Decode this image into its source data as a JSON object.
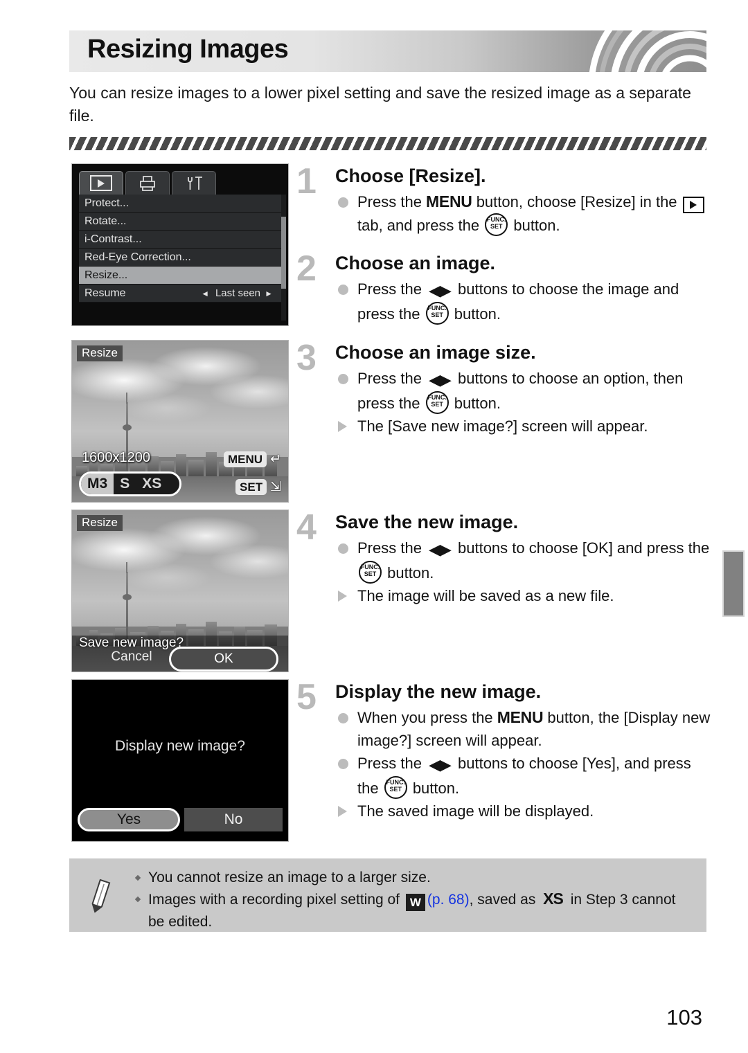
{
  "header": {
    "title": "Resizing Images",
    "intro": "You can resize images to a lower pixel setting and save the resized image as a separate file."
  },
  "camera_menu": {
    "tabs": [
      "playback-tab-icon",
      "print-tab-icon",
      "settings-tab-icon"
    ],
    "items": [
      {
        "label": "Protect...",
        "value": "",
        "selected": false
      },
      {
        "label": "Rotate...",
        "value": "",
        "selected": false
      },
      {
        "label": "i-Contrast...",
        "value": "",
        "selected": false
      },
      {
        "label": "Red-Eye Correction...",
        "value": "",
        "selected": false
      },
      {
        "label": "Resize...",
        "value": "",
        "selected": true
      },
      {
        "label": "Resume",
        "value": "Last seen",
        "selected": false
      }
    ]
  },
  "screen_resize_size": {
    "title": "Resize",
    "resolution": "1600x1200",
    "size_options": [
      "M3",
      "S",
      "XS"
    ],
    "selected_size": "M3",
    "menu_key": "MENU",
    "set_key": "SET"
  },
  "screen_save": {
    "title": "Resize",
    "question": "Save new image?",
    "cancel_label": "Cancel",
    "ok_label": "OK"
  },
  "screen_display": {
    "question": "Display new image?",
    "yes_label": "Yes",
    "no_label": "No"
  },
  "steps": [
    {
      "number": "1",
      "heading": "Choose [Resize].",
      "lines": [
        {
          "type": "dot",
          "parts": [
            {
              "t": "text",
              "v": "Press the "
            },
            {
              "t": "menu",
              "v": "MENU"
            },
            {
              "t": "text",
              "v": " button, choose [Resize] in the "
            },
            {
              "t": "play",
              "v": "playback-tab-icon"
            },
            {
              "t": "text",
              "v": " tab, and press the "
            },
            {
              "t": "func",
              "v": "FUNC./SET"
            },
            {
              "t": "text",
              "v": " button."
            }
          ]
        }
      ]
    },
    {
      "number": "2",
      "heading": "Choose an image.",
      "lines": [
        {
          "type": "dot",
          "parts": [
            {
              "t": "text",
              "v": "Press the "
            },
            {
              "t": "lr",
              "v": "◀▶"
            },
            {
              "t": "text",
              "v": " buttons to choose the image and press the "
            },
            {
              "t": "func",
              "v": "FUNC./SET"
            },
            {
              "t": "text",
              "v": " button."
            }
          ]
        }
      ]
    },
    {
      "number": "3",
      "heading": "Choose an image size.",
      "lines": [
        {
          "type": "dot",
          "parts": [
            {
              "t": "text",
              "v": "Press the "
            },
            {
              "t": "lr",
              "v": "◀▶"
            },
            {
              "t": "text",
              "v": " buttons to choose an option, then press the "
            },
            {
              "t": "func",
              "v": "FUNC./SET"
            },
            {
              "t": "text",
              "v": " button."
            }
          ]
        },
        {
          "type": "tri",
          "parts": [
            {
              "t": "text",
              "v": "The [Save new image?] screen will appear."
            }
          ]
        }
      ]
    },
    {
      "number": "4",
      "heading": "Save the new image.",
      "lines": [
        {
          "type": "dot",
          "parts": [
            {
              "t": "text",
              "v": "Press the "
            },
            {
              "t": "lr",
              "v": "◀▶"
            },
            {
              "t": "text",
              "v": " buttons to choose [OK] and press the "
            },
            {
              "t": "func",
              "v": "FUNC./SET"
            },
            {
              "t": "text",
              "v": " button."
            }
          ]
        },
        {
          "type": "tri",
          "parts": [
            {
              "t": "text",
              "v": "The image will be saved as a new file."
            }
          ]
        }
      ]
    },
    {
      "number": "5",
      "heading": "Display the new image.",
      "lines": [
        {
          "type": "dot",
          "parts": [
            {
              "t": "text",
              "v": "When you press the "
            },
            {
              "t": "menu",
              "v": "MENU"
            },
            {
              "t": "text",
              "v": " button, the [Display new image?] screen will appear."
            }
          ]
        },
        {
          "type": "dot",
          "parts": [
            {
              "t": "text",
              "v": "Press the "
            },
            {
              "t": "lr",
              "v": "◀▶"
            },
            {
              "t": "text",
              "v": " buttons to choose [Yes], and press the "
            },
            {
              "t": "func",
              "v": "FUNC./SET"
            },
            {
              "t": "text",
              "v": " button."
            }
          ]
        },
        {
          "type": "tri",
          "parts": [
            {
              "t": "text",
              "v": "The saved image will be displayed."
            }
          ]
        }
      ]
    }
  ],
  "note": {
    "icon": "pencil-icon",
    "lines": [
      [
        {
          "t": "text",
          "v": "You cannot resize an image to a larger size."
        }
      ],
      [
        {
          "t": "text",
          "v": "Images with a recording pixel setting of "
        },
        {
          "t": "wicon",
          "v": "W"
        },
        {
          "t": "link",
          "v": "(p. 68)"
        },
        {
          "t": "text",
          "v": ", saved as "
        },
        {
          "t": "xs",
          "v": "XS"
        },
        {
          "t": "text",
          "v": " in Step 3 cannot be edited."
        }
      ]
    ]
  },
  "page_number": "103",
  "colors": {
    "link": "#1433e0",
    "step_number": "#b9b9b9",
    "note_bg": "#c9c9c9",
    "selected_row": "#a7a9ab"
  }
}
